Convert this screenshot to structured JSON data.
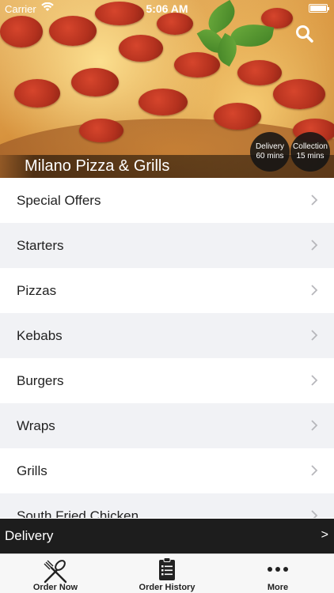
{
  "status_bar": {
    "carrier": "Carrier",
    "time": "5:06 AM"
  },
  "hero": {
    "restaurant_name": "Milano Pizza & Grills",
    "delivery_badge": {
      "label": "Delivery",
      "time": "60 mins"
    },
    "collection_badge": {
      "label": "Collection",
      "time": "15 mins"
    }
  },
  "menu": {
    "items": [
      {
        "label": "Special Offers"
      },
      {
        "label": "Starters"
      },
      {
        "label": "Pizzas"
      },
      {
        "label": "Kebabs"
      },
      {
        "label": "Burgers"
      },
      {
        "label": "Wraps"
      },
      {
        "label": "Grills"
      },
      {
        "label": "South Fried Chicken"
      }
    ]
  },
  "delivery_bar": {
    "label": "Delivery",
    "arrow": ">"
  },
  "tab_bar": {
    "tabs": [
      {
        "label": "Order Now",
        "icon": "fork-knife-icon"
      },
      {
        "label": "Order History",
        "icon": "clipboard-list-icon"
      },
      {
        "label": "More",
        "icon": "more-dots-icon"
      }
    ]
  },
  "colors": {
    "delivery_bar_bg": "#1d1d1d",
    "badge_bg": "#141414",
    "row_alt_bg": "#f1f2f5"
  }
}
